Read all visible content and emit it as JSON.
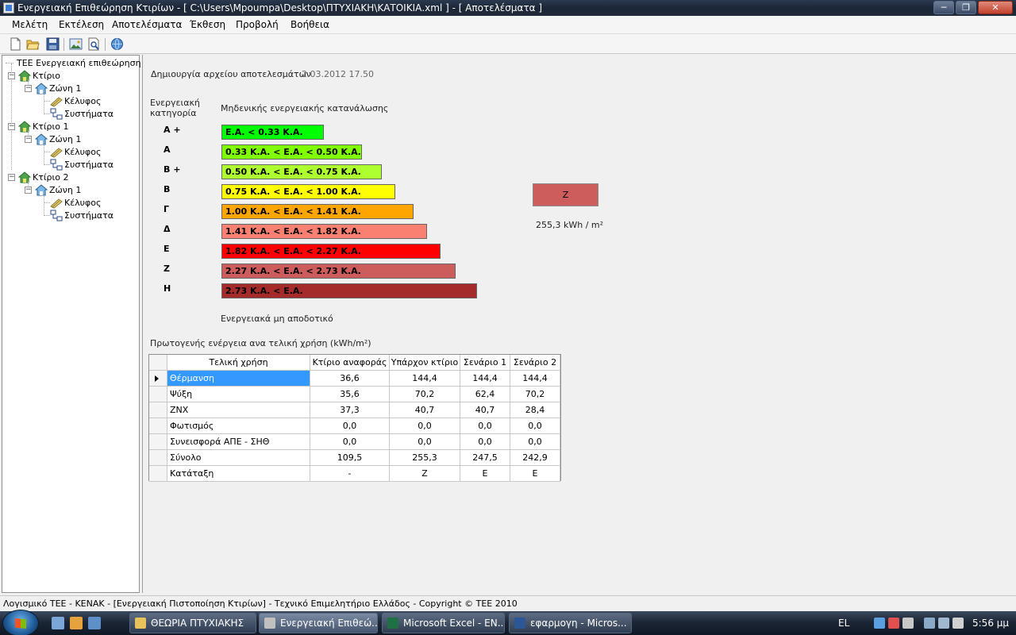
{
  "window": {
    "title": "Ενεργειακή Επιθεώρηση Κτιρίων - [ C:\\Users\\Mpoumpa\\Desktop\\ΠΤΥΧΙΑΚΗ\\ΚΑΤΟΙΚΙΑ.xml ] - [ Αποτελέσματα ]",
    "minimize": "─",
    "maximize": "❐",
    "close": "✕"
  },
  "menu": [
    "Μελέτη",
    "Εκτέλεση",
    "Αποτελέσματα",
    "Έκθεση",
    "Προβολή",
    "Βοήθεια"
  ],
  "toolbar": {
    "icons": [
      "new-file-icon",
      "open-folder-icon",
      "save-icon",
      "image-icon",
      "print-preview-icon",
      "help-globe-icon"
    ]
  },
  "tree": {
    "root": "ΤΕΕ Ενεργειακή επιθεώρηση",
    "nodes": [
      {
        "building": "Κτίριο",
        "zone": "Ζώνη 1",
        "shell": "Κέλυφος",
        "systems": "Συστήματα"
      },
      {
        "building": "Κτίριο 1",
        "zone": "Ζώνη 1",
        "shell": "Κέλυφος",
        "systems": "Συστήματα"
      },
      {
        "building": "Κτίριο 2",
        "zone": "Ζώνη 1",
        "shell": "Κέλυφος",
        "systems": "Συστήματα"
      }
    ]
  },
  "results": {
    "file_created_label": "Δημιουργία αρχείου αποτελεσμάτων",
    "file_created_date": "2.03.2012 17.50",
    "category_label_1": "Ενεργειακή",
    "category_label_2": "κατηγορία",
    "top_label": "Μηδενικής ενεργειακής κατανάλωσης",
    "bottom_label": "Ενεργειακά μη αποδοτικό",
    "classes": [
      {
        "cat": "Α +",
        "range": "Ε.Α. < 0.33 Κ.Α.",
        "color": "#00ff00"
      },
      {
        "cat": "Α",
        "range": "0.33 Κ.Α. <  Ε.Α. < 0.50 Κ.Α.",
        "color": "#7fff00"
      },
      {
        "cat": "Β +",
        "range": "0.50 Κ.Α. <  Ε.Α. < 0.75 Κ.Α.",
        "color": "#adff2f"
      },
      {
        "cat": "Β",
        "range": "0.75 Κ.Α. <  Ε.Α. < 1.00 Κ.Α.",
        "color": "#ffff00"
      },
      {
        "cat": "Γ",
        "range": "1.00 Κ.Α. <  Ε.Α. < 1.41 Κ.Α.",
        "color": "#ffa500"
      },
      {
        "cat": "Δ",
        "range": "1.41 Κ.Α. <  Ε.Α. < 1.82 Κ.Α.",
        "color": "#fa8072"
      },
      {
        "cat": "Ε",
        "range": "1.82 Κ.Α. <  Ε.Α. < 2.27 Κ.Α.",
        "color": "#ff0000"
      },
      {
        "cat": "Ζ",
        "range": "2.27 Κ.Α. <  Ε.Α. < 2.73 Κ.Α.",
        "color": "#cd5c5c"
      },
      {
        "cat": "Η",
        "range": "2.73 Κ.Α. <  Ε.Α.",
        "color": "#a52a2a"
      }
    ],
    "rating": {
      "value": "Ζ",
      "color": "#cd5c5c",
      "energy": "255,3 kWh / m²"
    },
    "table_title": "Πρωτογενής ενέργεια ανα τελική χρήση (kWh/m²)",
    "table": {
      "columns": [
        "Τελική χρήση",
        "Κτίριο αναφοράς",
        "Υπάρχον κτίριο",
        "Σενάριο 1",
        "Σενάριο 2"
      ],
      "rows": [
        [
          "Θέρμανση",
          "36,6",
          "144,4",
          "144,4",
          "144,4"
        ],
        [
          "Ψύξη",
          "35,6",
          "70,2",
          "62,4",
          "70,2"
        ],
        [
          "ΖΝΧ",
          "37,3",
          "40,7",
          "40,7",
          "28,4"
        ],
        [
          "Φωτισμός",
          "0,0",
          "0,0",
          "0,0",
          "0,0"
        ],
        [
          "Συνεισφορά ΑΠΕ - ΣΗΘ",
          "0,0",
          "0,0",
          "0,0",
          "0,0"
        ],
        [
          "Σύνολο",
          "109,5",
          "255,3",
          "247,5",
          "242,9"
        ],
        [
          "Κατάταξη",
          "-",
          "Ζ",
          "Ε",
          "Ε"
        ]
      ]
    }
  },
  "status": "Λογισμικό ΤΕΕ - ΚΕΝΑΚ  -  [Ενεργειακή Πιστοποίηση Κτιρίων]  -  Τεχνικό Επιμελητήριο Ελλάδος  -  Copyright © ΤΕΕ 2010",
  "taskbar": {
    "buttons": [
      {
        "label": "ΘΕΩΡΙΑ ΠΤΥΧΙΑΚΗΣ",
        "icon_color": "#e8c25a"
      },
      {
        "label": "Ενεργειακή Επιθεώ...",
        "icon_color": "#c0c0c0"
      },
      {
        "label": "Microsoft Excel - EN...",
        "icon_color": "#1e7145"
      },
      {
        "label": "εφαρμογη - Micros...",
        "icon_color": "#2b5797"
      }
    ],
    "language": "EL",
    "clock": "5:56 μμ"
  }
}
